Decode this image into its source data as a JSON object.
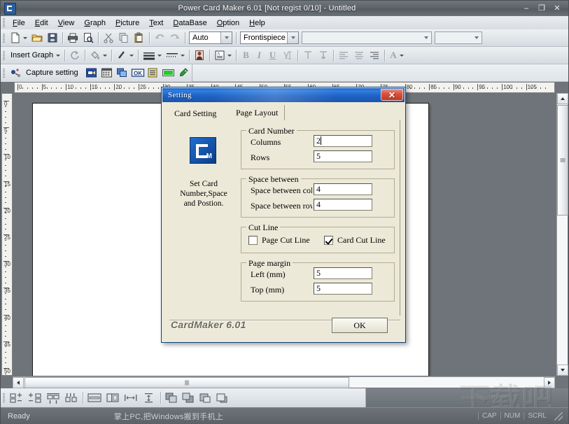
{
  "window": {
    "title": "Power Card Maker 6.01 [Not regist 0/10] - Untitled",
    "icon": "cardmaker-app-icon",
    "minimize": "–",
    "maximize": "❐",
    "close": "✕"
  },
  "menubar": {
    "items": [
      {
        "label": "File"
      },
      {
        "label": "Edit"
      },
      {
        "label": "View"
      },
      {
        "label": "Graph"
      },
      {
        "label": "Picture"
      },
      {
        "label": "Text"
      },
      {
        "label": "DataBase"
      },
      {
        "label": "Option"
      },
      {
        "label": "Help"
      }
    ]
  },
  "toolbar_standard": {
    "buttons": [
      {
        "name": "new-file-icon"
      },
      {
        "name": "open-file-icon"
      },
      {
        "name": "save-file-icon"
      },
      {
        "name": "print-icon"
      },
      {
        "name": "print-preview-icon"
      },
      {
        "name": "cut-icon"
      },
      {
        "name": "copy-icon"
      },
      {
        "name": "paste-icon"
      },
      {
        "name": "undo-icon"
      },
      {
        "name": "redo-icon"
      }
    ],
    "zoom_combo": {
      "value": "Auto"
    },
    "page_combo": {
      "value": "Frontispiece"
    },
    "object_combo": {
      "value": ""
    },
    "extra_combo": {
      "value": ""
    }
  },
  "toolbar_graph": {
    "insert_graph_label": "Insert Graph",
    "buttons": [
      {
        "name": "rotate-icon"
      },
      {
        "name": "fill-color-icon"
      },
      {
        "name": "line-color-icon"
      },
      {
        "name": "line-width-icon"
      },
      {
        "name": "line-style-icon"
      },
      {
        "name": "image-effect-icon"
      },
      {
        "name": "text-frame-icon"
      },
      {
        "name": "bold-icon",
        "label": "B"
      },
      {
        "name": "italic-icon",
        "label": "I"
      },
      {
        "name": "underline-icon",
        "label": "U"
      },
      {
        "name": "text-direction-icon"
      },
      {
        "name": "text-top-icon"
      },
      {
        "name": "text-bottom-icon"
      },
      {
        "name": "align-left-icon"
      },
      {
        "name": "align-center-icon"
      },
      {
        "name": "align-right-icon"
      },
      {
        "name": "font-color-icon",
        "label": "A"
      }
    ]
  },
  "toolbar_capture": {
    "capture_setting_label": "Capture setting",
    "buttons": [
      {
        "name": "capture-window-icon"
      },
      {
        "name": "capture-grid-icon"
      },
      {
        "name": "capture-copy-icon"
      },
      {
        "name": "capture-ok-icon"
      },
      {
        "name": "capture-list-icon"
      },
      {
        "name": "capture-color-icon"
      },
      {
        "name": "eyedropper-icon"
      }
    ]
  },
  "toolbar_align": {
    "buttons": [
      {
        "name": "align-objects-left-icon"
      },
      {
        "name": "align-objects-right-icon"
      },
      {
        "name": "align-objects-top-icon"
      },
      {
        "name": "align-objects-bottom-icon"
      },
      {
        "name": "align-center-horizontal-icon"
      },
      {
        "name": "align-center-vertical-icon"
      },
      {
        "name": "distribute-horizontal-icon"
      },
      {
        "name": "distribute-vertical-icon"
      },
      {
        "name": "bring-to-front-icon"
      },
      {
        "name": "send-to-back-icon"
      },
      {
        "name": "bring-forward-icon"
      },
      {
        "name": "send-backward-icon"
      }
    ]
  },
  "rulers": {
    "horizontal_unit": "mm",
    "horizontal_ticks": [
      0,
      5,
      10,
      15,
      20,
      25,
      30,
      35,
      40,
      45,
      50,
      55,
      60,
      65,
      70,
      75,
      80,
      85,
      90,
      95,
      100,
      105
    ],
    "vertical_ticks": [
      0,
      5,
      10,
      15,
      20,
      25,
      30,
      35,
      40,
      45,
      50
    ]
  },
  "scrollbars": {
    "vertical": {
      "up": "▲",
      "down": "▼"
    },
    "horizontal": {
      "left": "◄",
      "right": "►"
    }
  },
  "statusbar": {
    "ready": "Ready",
    "promo": "掌上PC,把Windows搬到手机上",
    "indicators": [
      "CAP",
      "NUM",
      "SCRL"
    ]
  },
  "watermark": {
    "text": "下载吧",
    "sub": "www.xiazaiba.com"
  },
  "dialog": {
    "title": "Setting",
    "close_label": "✕",
    "tabs": [
      {
        "label": "Card Setting",
        "active": false
      },
      {
        "label": "Page Layout",
        "active": true
      }
    ],
    "side": {
      "icon": "cardmaker-logo-icon",
      "icon_text": "M",
      "description": "Set Card Number,Space and Postion."
    },
    "groups": {
      "card_number": {
        "legend": "Card Number",
        "fields": [
          {
            "label": "Columns",
            "value": "2",
            "focused": true
          },
          {
            "label": "Rows",
            "value": "5",
            "focused": false
          }
        ]
      },
      "space_between": {
        "legend": "Space between",
        "fields": [
          {
            "label": "Space between column",
            "value": "4",
            "focused": false
          },
          {
            "label": "Space between rows",
            "value": "4",
            "focused": false
          }
        ]
      },
      "cut_line": {
        "legend": "Cut Line",
        "checkboxes": [
          {
            "label": "Page Cut Line",
            "checked": false
          },
          {
            "label": "Card Cut Line",
            "checked": true
          }
        ]
      },
      "page_margin": {
        "legend": "Page margin",
        "fields": [
          {
            "label": "Left (mm)",
            "value": "5",
            "focused": false
          },
          {
            "label": "Top (mm)",
            "value": "5",
            "focused": false
          }
        ]
      }
    },
    "brand": "CardMaker 6.01",
    "ok_label": "OK"
  },
  "colors": {
    "window_chrome": "#6e7479",
    "dialog_face": "#ece9d8",
    "dialog_title_blue": "#1f62c4",
    "close_red": "#c23a22",
    "accent_blue": "#0c3d86",
    "page_white": "#ffffff"
  }
}
